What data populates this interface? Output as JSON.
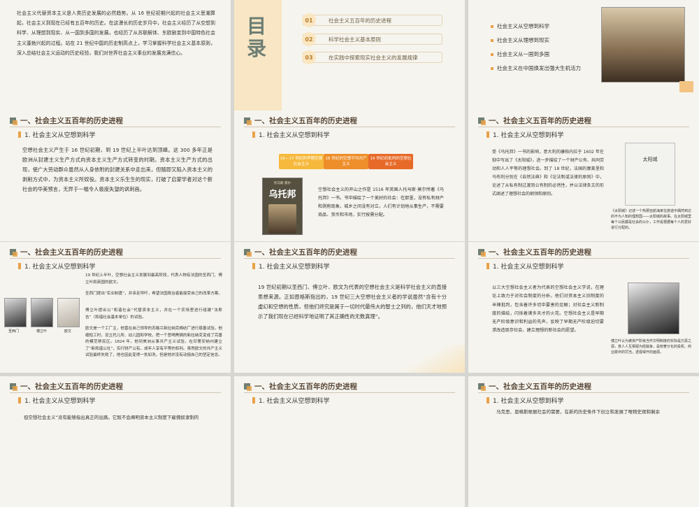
{
  "s1": {
    "intro": "社会主义代替资本主义是人类历史发展的必然趋势。从 16 世纪初期兴起的社会主义思潮算起，社会主义到现在已经有五百年的历史。在这漫长的历史岁月中，社会主义经历了从空想到科学、从理想到现实、从一国到多国的发展，也经历了从苏联解体、东欧剧变到中国特色社会主义蓬勃兴起的过程。站在 21 世纪中国的历史制高点上，学习掌握科学社会主义基本原则，深入总结社会主义运动的历史经验，我们对世界社会主义事业的发展充满信心。"
  },
  "s2": {
    "title": "目录",
    "items": [
      {
        "num": "01",
        "label": "社会主义五百年的历史进程"
      },
      {
        "num": "02",
        "label": "科学社会主义基本原则"
      },
      {
        "num": "03",
        "label": "在实践中探索现实社会主义的发展规律"
      }
    ]
  },
  "s3": {
    "bullets": [
      "社会主义从空想到科学",
      "社会主义从理想到现实",
      "社会主义从一国到多国",
      "社会主义在中国焕发出强大生机活力"
    ]
  },
  "section_title": "一、社会主义五百年的历史进程",
  "sub_title": "1. 社会主义从空想到科学",
  "s4": {
    "text": "空想社会主义产生于 16 世纪初期，到 19 世纪上半叶达到顶峰。这 300 多年正是欧洲从封建主义生产方式向资本主义生产方式转变的时期。资本主义生产方式的出现，使广大劳动群众虽然从人身依附的封建关系中走出来，但随即又陷入资本主义的剥削方式中，为资本主义所奴役。资本主义乐生生的现实，打破了启蒙学者对这个新社会的华美预言，无异于一幅令人极度失望的讽刺画。"
  },
  "s5": {
    "tags": [
      "16—17 世纪的早期空想社会主义",
      "18 世纪的空想平均共产主义",
      "19 世纪初批判的空想社会主义"
    ],
    "book_title": "乌托邦",
    "book_sub": "托马斯·莫尔",
    "text": "空想社会主义的开山之作是 1516 年英国人托马斯·莫尔所著《乌托邦》一书。书中描绘了一个美好的社会：在那里，没有私有财产和剥削现象，城乡之间没有对立，人们有计划地从事生产，不需要商品、货币和市场，实行按需分配。"
  },
  "s6": {
    "text": "受《乌托邦》一书的影响，意大利的康帕内拉于 1602 年在狱中写出了《太阳城》，进一步描绘了一个财产公有、共同劳动和人人平等的理想社会。到了 18 世纪，法国的摩莱里和马布利分别在《自然法典》和《论法制或法律的原则》中，论述了从私有制过渡到公有制的必然性，并以法律条文的形式阐述了理想社会的纲领和原则。",
    "book_title": "太阳城",
    "caption": "《太阳城》记述一个热那亚航海家在旅途中偶然到达的不为人知的理想国——太阳城的故事。在太阳城里每个公民都是社会的公仆，工作是根据每个人的爱好进行分配的。"
  },
  "s7": {
    "paras": [
      "19 世纪上半叶，空想社会主义发展到最高阶段，代表人物有法国的圣西门、傅立叶和英国的欧文。",
      "圣西门提出“实业制度”，并亲走呼吁，希望法国政治者能接受自己的改革方案。",
      "傅立叶提出以“和谐社会”代替资本主义，并在一个农场里进行组建“法郎吉”（和谐社会基本单位）的试验。",
      "欧文是一个工厂主，他曾在自己领导的苏格兰新拉纳克棉纺厂进行慈善试验，他缩短工时，设立托儿所、幼儿园和学校，把一个恶喝黑辆的新拉纳克变成了完善的模范移民区。1824 年，他到美洲从事共产主义试验，在印第安纳州建立了“新和谐公社”，实行财产公有，成年人享有平等的权利。虽然欧文的共产主义试验最终失败了，他也因此变得一贫如洗，但是他并没有动摇自己的坚定信念。"
    ],
    "captions": [
      "圣西门",
      "傅立叶",
      "欧文"
    ]
  },
  "s8": {
    "text": "19 世纪初期以圣西门、傅立叶、欧文为代表的空想社会主义是科学社会主义的直接思想来源。正如恩格斯指出的，19 世纪三大空想社会主义者的学说虽然“含有十分虚幻和空想的性质，但他们终究是属于一切时代最伟大的智士之列的，他们天才地预示了我们现在已经科学地证明了其正确性的无数真理”。"
  },
  "s9": {
    "text": "以三大空想社会主义者为代表的空想社会主义学说，在理论上致力于对社会制度的分析。他们对资本主义旧制度的辛辣批判，包含着许多切中要害的见解；对社会主义新制度的描绘，闪烁着诸多天才的火花。空想社会主义是早期无产阶级意识和利益的先声，反映了早期无产阶级迫切要求改造现存社会、建立理想的新社会的愿望。",
    "caption": "傅立叶认为被资产阶级当作文明制度的实际是万恶之源，意人人互相视为经敌争，是权奢分化的投机、商业欺诈的罚当，透视得开的面源。"
  },
  "s10": {
    "text": "但空想社会主义“没有能够指出真正的出路。它既不会阐明资本主义制度下雇佣奴隶制的"
  },
  "s12": {
    "text": "马克思、恩格斯根据社会的需要，在新的历史条件下创立和发展了唯物史观和剩余"
  }
}
